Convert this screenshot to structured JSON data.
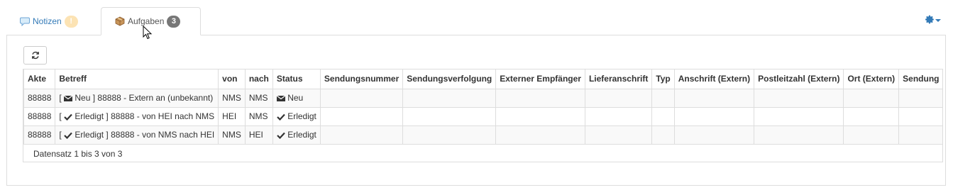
{
  "tabs": [
    {
      "label": "Notizen",
      "badge": "!",
      "icon": "speech-bubble-icon"
    },
    {
      "label": "Aufgaben",
      "badge": "3",
      "icon": "package-icon"
    }
  ],
  "settings_icon": "gear-icon",
  "refresh_icon": "refresh-icon",
  "table": {
    "headers": [
      "Akte",
      "Betreff",
      "von",
      "nach",
      "Status",
      "Sendungsnummer",
      "Sendungsverfolgung",
      "Externer Empfänger",
      "Lieferanschrift",
      "Typ",
      "Anschrift (Extern)",
      "Postleitzahl (Extern)",
      "Ort (Extern)",
      "Sendung"
    ],
    "rows": [
      {
        "akte": "88888",
        "betreff_status": "Neu",
        "betreff_icon": "envelope-icon",
        "betreff_text": "88888 - Extern an (unbekannt)",
        "von": "NMS",
        "nach": "NMS",
        "status": "Neu",
        "status_icon": "envelope-icon"
      },
      {
        "akte": "88888",
        "betreff_status": "Erledigt",
        "betreff_icon": "check-icon",
        "betreff_text": "88888 - von HEI nach NMS",
        "von": "HEI",
        "nach": "NMS",
        "status": "Erledigt",
        "status_icon": "check-icon"
      },
      {
        "akte": "88888",
        "betreff_status": "Erledigt",
        "betreff_icon": "check-icon",
        "betreff_text": "88888 - von NMS nach HEI",
        "von": "NMS",
        "nach": "HEI",
        "status": "Erledigt",
        "status_icon": "check-icon"
      }
    ],
    "footer": "Datensatz 1 bis 3 von 3"
  },
  "colors": {
    "link": "#337ab7",
    "border": "#dddddd",
    "badge_dark": "#777777",
    "badge_warn": "#fce3b4"
  }
}
